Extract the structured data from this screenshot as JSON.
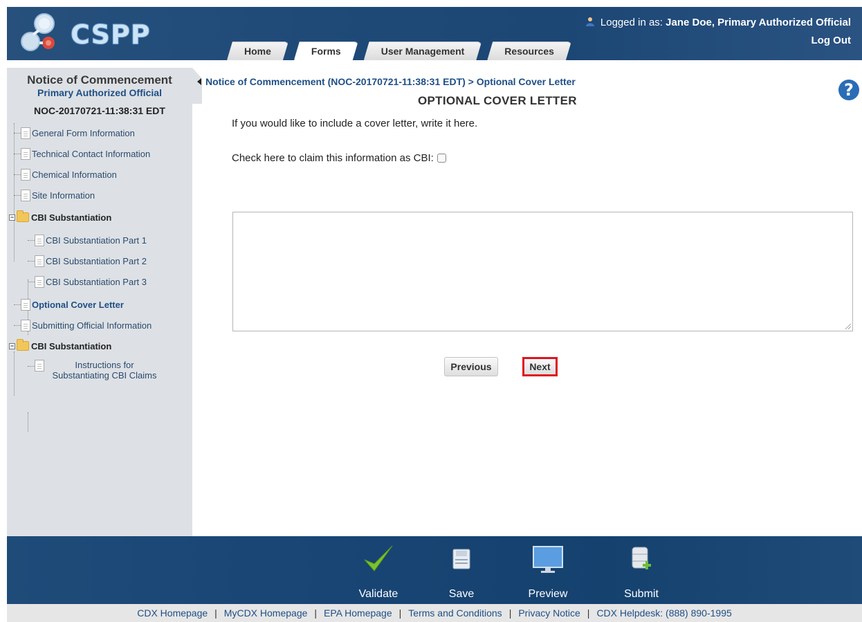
{
  "header": {
    "logo_text": "CSPP",
    "login_prefix": "Logged in as:",
    "login_user": "Jane Doe, Primary Authorized Official",
    "logout_label": "Log Out",
    "tabs": [
      {
        "label": "Home",
        "active": false
      },
      {
        "label": "Forms",
        "active": true
      },
      {
        "label": "User Management",
        "active": false
      },
      {
        "label": "Resources",
        "active": false
      }
    ]
  },
  "sidebar": {
    "title": "Notice of Commencement",
    "subtitle": "Primary Authorized Official",
    "form_id": "NOC-20170721-11:38:31 EDT",
    "items": [
      {
        "label": "General Form Information",
        "type": "doc",
        "level": 1
      },
      {
        "label": "Technical Contact Information",
        "type": "doc",
        "level": 1
      },
      {
        "label": "Chemical Information",
        "type": "doc",
        "level": 1
      },
      {
        "label": "Site Information",
        "type": "doc",
        "level": 1
      },
      {
        "label": "CBI Substantiation",
        "type": "folder",
        "level": 1
      },
      {
        "label": "CBI Substantiation Part 1",
        "type": "doc",
        "level": 2
      },
      {
        "label": "CBI Substantiation Part 2",
        "type": "doc",
        "level": 2
      },
      {
        "label": "CBI Substantiation Part 3",
        "type": "doc",
        "level": 2
      },
      {
        "label": "Optional Cover Letter",
        "type": "doc",
        "level": 1,
        "current": true
      },
      {
        "label": "Submitting Official Information",
        "type": "doc",
        "level": 1
      },
      {
        "label": "CBI Substantiation",
        "type": "folder",
        "level": 1
      },
      {
        "label": "Instructions for Substantiating CBI Claims",
        "type": "doc",
        "level": 2
      }
    ]
  },
  "main": {
    "breadcrumb": "Notice of Commencement (NOC-20170721-11:38:31 EDT) > Optional Cover Letter",
    "help_symbol": "?",
    "page_title": "OPTIONAL COVER LETTER",
    "intro_text": "If you would like to include a cover letter, write it here.",
    "cbi_label": "Check here to claim this information as CBI:",
    "cbi_checked": false,
    "cover_letter_value": "",
    "previous_label": "Previous",
    "next_label": "Next"
  },
  "toolbar": {
    "validate_label": "Validate",
    "save_label": "Save",
    "preview_label": "Preview",
    "submit_label": "Submit"
  },
  "footer": {
    "links": [
      "CDX Homepage",
      "MyCDX Homepage",
      "EPA Homepage",
      "Terms and Conditions",
      "Privacy Notice",
      "CDX Helpdesk: (888) 890-1995"
    ],
    "separator": "|"
  },
  "colors": {
    "header_bg": "#1f4a78",
    "sidebar_bg": "#dde1e5",
    "link_blue": "#1f4f86",
    "highlight_red": "#e0141e",
    "validate_green": "#7dc32a"
  },
  "icons": {
    "logo": "cspp-molecule-logo",
    "user": "user-icon",
    "help": "help-icon",
    "validate": "checkmark-icon",
    "save": "floppy-disk-icon",
    "preview": "monitor-icon",
    "submit": "database-plus-icon"
  }
}
